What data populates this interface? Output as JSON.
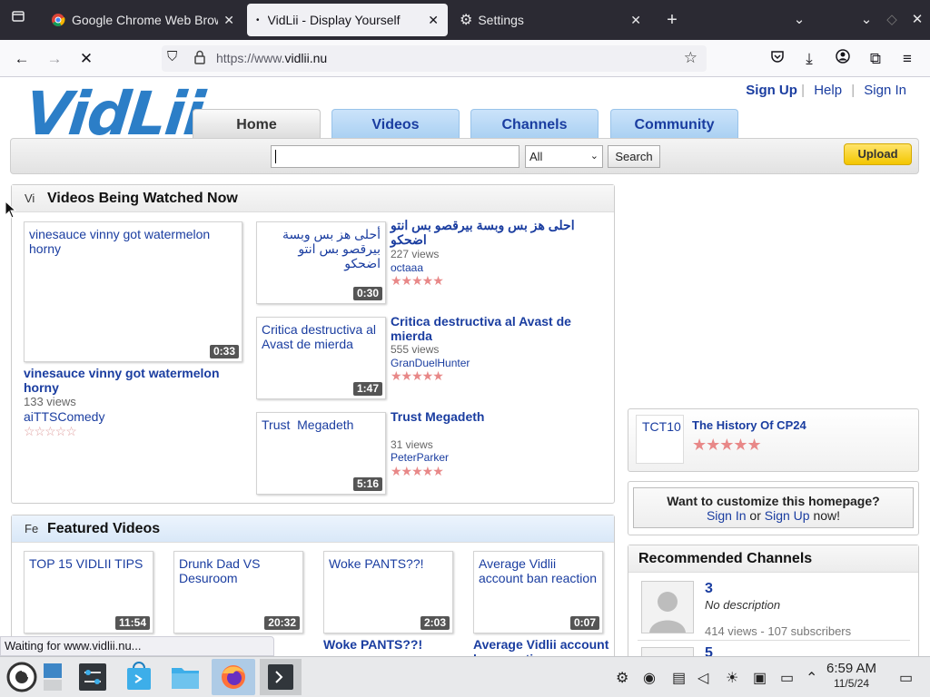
{
  "browser": {
    "tabs": [
      {
        "title": "Google Chrome Web Brow",
        "favicon": "chrome-icon"
      },
      {
        "title": "VidLii - Display Yourself",
        "favicon": "dot-icon"
      },
      {
        "title": "Settings",
        "favicon": "gear-icon"
      }
    ],
    "url_prefix": "https://www.",
    "url_domain": "vidlii.nu",
    "status": "Waiting for www.vidlii.nu..."
  },
  "site": {
    "logo": "VidLii",
    "toplinks": [
      "Sign Up",
      "Help",
      "Sign In"
    ],
    "nav": [
      "Home",
      "Videos",
      "Channels",
      "Community"
    ],
    "search": {
      "category": "All",
      "button": "Search"
    },
    "upload": "Upload"
  },
  "watching": {
    "heading": "Videos Being Watched Now",
    "icon_text": "Vi",
    "main": {
      "thumb_title": "vinesauce vinny got watermelon horny",
      "duration": "0:33",
      "title": "vinesauce vinny got watermelon horny",
      "views": "133 views",
      "author": "aiTTSComedy",
      "stars": "☆☆☆☆☆"
    },
    "items": [
      {
        "thumb_title": "أحلى هز بس وبسة بيرقصو بس انتو اضحكو",
        "duration": "0:30",
        "title": "احلى هز بس وبسة بيرقصو بس انتو اضحكو",
        "views": "227 views",
        "author": "octaaa",
        "stars": "★★★★★"
      },
      {
        "thumb_title": "Critica destructiva al Avast de mierda",
        "duration": "1:47",
        "title": "Critica destructiva al Avast de mierda",
        "views": "555 views",
        "author": "GranDuelHunter",
        "stars": "★★★★★"
      },
      {
        "thumb_title": "Trust  Megadeth",
        "duration": "5:16",
        "title": "Trust Megadeth",
        "views": "31 views",
        "author": "PeterParker",
        "stars": "★★★★★"
      }
    ]
  },
  "sidebar": {
    "tct": {
      "thumb": "TCT10",
      "title": "The History Of CP24",
      "stars": "★★★★★"
    },
    "customize": {
      "question": "Want to customize this homepage?",
      "sign_in": "Sign In",
      "or": "or",
      "sign_up": "Sign Up",
      "suffix": "now!"
    },
    "recommended": {
      "heading": "Recommended Channels",
      "channels": [
        {
          "name": "3",
          "desc": "No description",
          "stats": "414 views - 107 subscribers"
        },
        {
          "name": "5"
        }
      ]
    }
  },
  "featured": {
    "heading": "Featured Videos",
    "icon_text": "Fe",
    "items": [
      {
        "thumb_title": "TOP 15 VIDLII TIPS",
        "duration": "11:54"
      },
      {
        "thumb_title": "Drunk Dad VS Desuroom",
        "duration": "20:32"
      },
      {
        "thumb_title": "Woke PANTS??!",
        "duration": "2:03",
        "title": "Woke PANTS??!"
      },
      {
        "thumb_title": "Average Vidlii account ban reaction",
        "duration": "0:07",
        "title": "Average Vidlii account ban reaction"
      }
    ]
  },
  "taskbar": {
    "time": "6:59 AM",
    "date": "11/5/24"
  }
}
